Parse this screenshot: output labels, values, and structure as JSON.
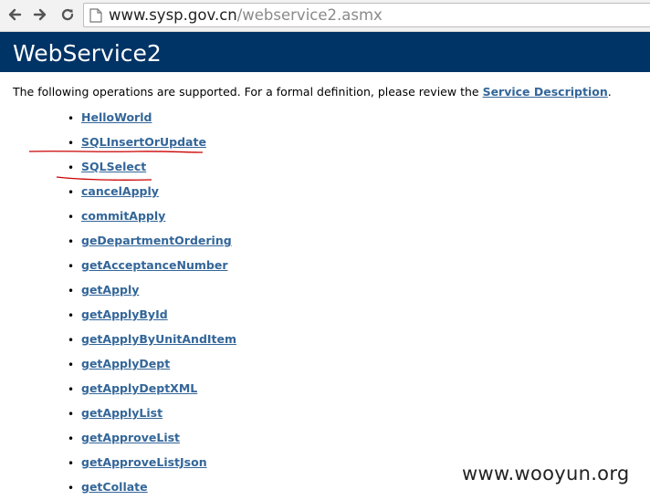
{
  "browser": {
    "url_host": "www.sysp.gov.cn",
    "url_path": "/webservice2.asmx"
  },
  "page": {
    "title": "WebService2",
    "intro_text": "The following operations are supported. For a formal definition, please review the ",
    "intro_link": "Service Description",
    "intro_end": "."
  },
  "operations": [
    "HelloWorld",
    "SQLInsertOrUpdate",
    "SQLSelect",
    "cancelApply",
    "commitApply",
    "geDepartmentOrdering",
    "getAcceptanceNumber",
    "getApply",
    "getApplyById",
    "getApplyByUnitAndItem",
    "getApplyDept",
    "getApplyDeptXML",
    "getApplyList",
    "getApproveList",
    "getApproveListJson",
    "getCollate"
  ],
  "colors": {
    "header_bg": "#003366",
    "link": "#336699",
    "annotation": "#cc0000"
  },
  "icons": [
    "back-arrow-icon",
    "forward-arrow-icon",
    "reload-icon",
    "page-icon"
  ],
  "watermark": "www.wooyun.org"
}
